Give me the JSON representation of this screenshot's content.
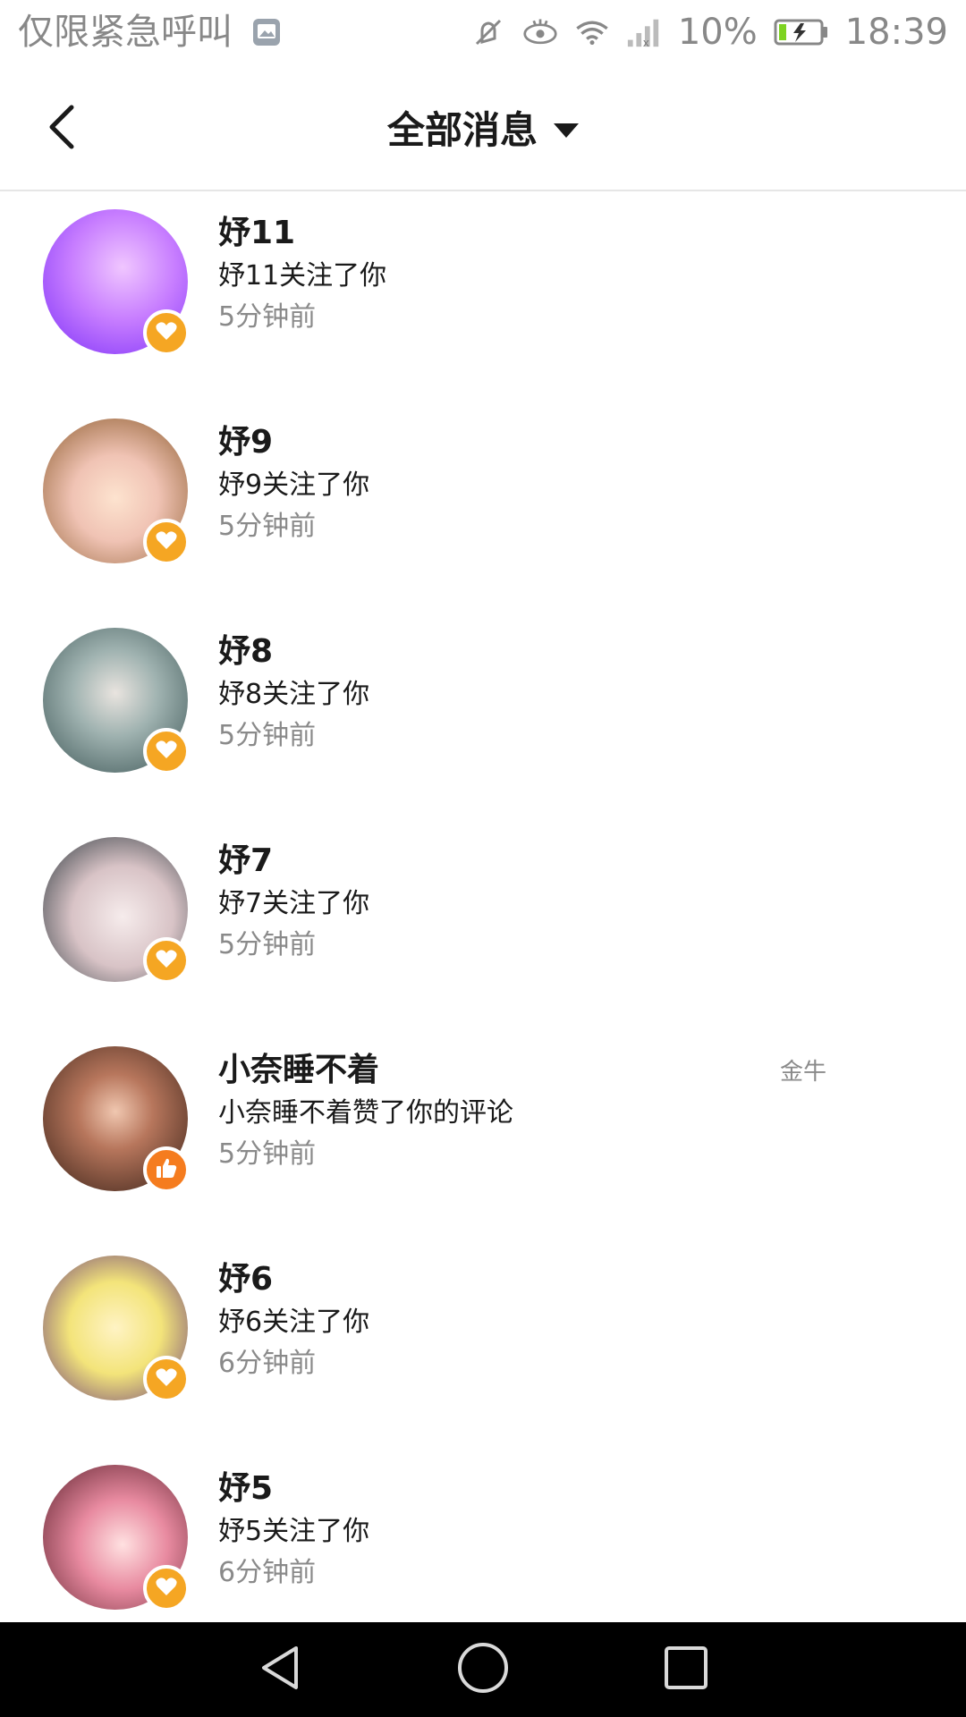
{
  "status_bar": {
    "carrier_text": "仅限紧急呼叫",
    "battery_percent": "10%",
    "time": "18:39",
    "icons": [
      "gallery-icon",
      "mute-icon",
      "eye-icon",
      "wifi-icon",
      "signal-icon",
      "battery-charging-icon"
    ]
  },
  "header": {
    "title": "全部消息",
    "back_icon": "back-chevron-icon",
    "dropdown_icon": "caret-down-icon"
  },
  "messages": [
    {
      "name": "妤11",
      "text": "妤11关注了你",
      "time": "5分钟前",
      "tag": "",
      "badge": "heart-icon",
      "badge_color": "#f5a623",
      "avatar_color": "#c77dff"
    },
    {
      "name": "妤9",
      "text": "妤9关注了你",
      "time": "5分钟前",
      "tag": "",
      "badge": "heart-icon",
      "badge_color": "#f5a623",
      "avatar_color": "#f0c3b4"
    },
    {
      "name": "妤8",
      "text": "妤8关注了你",
      "time": "5分钟前",
      "tag": "",
      "badge": "heart-icon",
      "badge_color": "#f5a623",
      "avatar_color": "#6f8a8a"
    },
    {
      "name": "妤7",
      "text": "妤7关注了你",
      "time": "5分钟前",
      "tag": "",
      "badge": "heart-icon",
      "badge_color": "#f5a623",
      "avatar_color": "#d8c3c6"
    },
    {
      "name": "小奈睡不着",
      "text": "小奈睡不着赞了你的评论",
      "time": "5分钟前",
      "tag": "金牛",
      "badge": "thumbs-up-icon",
      "badge_color": "#f57c1f",
      "avatar_color": "#7a4a3a"
    },
    {
      "name": "妤6",
      "text": "妤6关注了你",
      "time": "6分钟前",
      "tag": "",
      "badge": "heart-icon",
      "badge_color": "#f5a623",
      "avatar_color": "#f3e47a"
    },
    {
      "name": "妤5",
      "text": "妤5关注了你",
      "time": "6分钟前",
      "tag": "",
      "badge": "heart-icon",
      "badge_color": "#f5a623",
      "avatar_color": "#d9627d"
    }
  ],
  "navbar": {
    "buttons": [
      "nav-back-icon",
      "nav-home-icon",
      "nav-recents-icon"
    ]
  },
  "colors": {
    "header_divider": "#e6e6e6",
    "secondary_text": "#8a8a8a",
    "heart_badge": "#f5a623",
    "like_badge": "#f57c1f",
    "navbar_bg": "#000000"
  }
}
